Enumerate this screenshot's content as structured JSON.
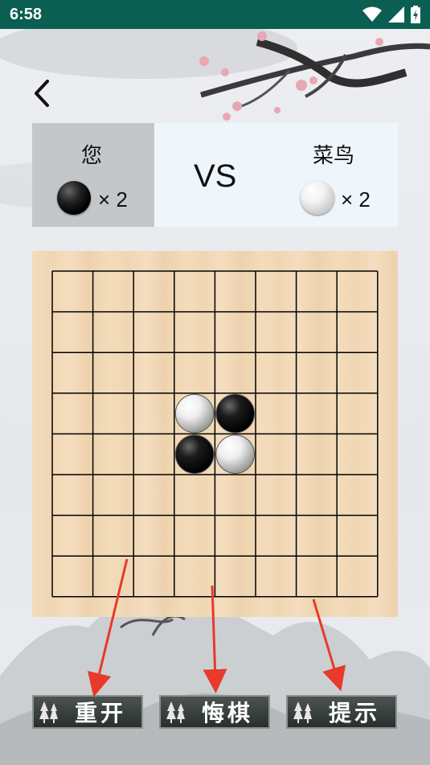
{
  "status_bar": {
    "time": "6:58"
  },
  "scoreboard": {
    "you": {
      "name": "您",
      "stone_count": "× 2",
      "stone_color": "black"
    },
    "vs_label": "VS",
    "opponent": {
      "name": "菜鸟",
      "stone_count": "× 2",
      "stone_color": "white"
    }
  },
  "board": {
    "size": 8,
    "line_color": "#000000",
    "stones": [
      {
        "row": 3,
        "col": 3,
        "color": "white"
      },
      {
        "row": 3,
        "col": 4,
        "color": "black"
      },
      {
        "row": 4,
        "col": 3,
        "color": "black"
      },
      {
        "row": 4,
        "col": 4,
        "color": "white"
      }
    ]
  },
  "buttons": {
    "restart": "重开",
    "undo": "悔棋",
    "hint": "提示"
  },
  "colors": {
    "status_bar": "#0b5f52",
    "annotation_arrow": "#e8392b"
  }
}
